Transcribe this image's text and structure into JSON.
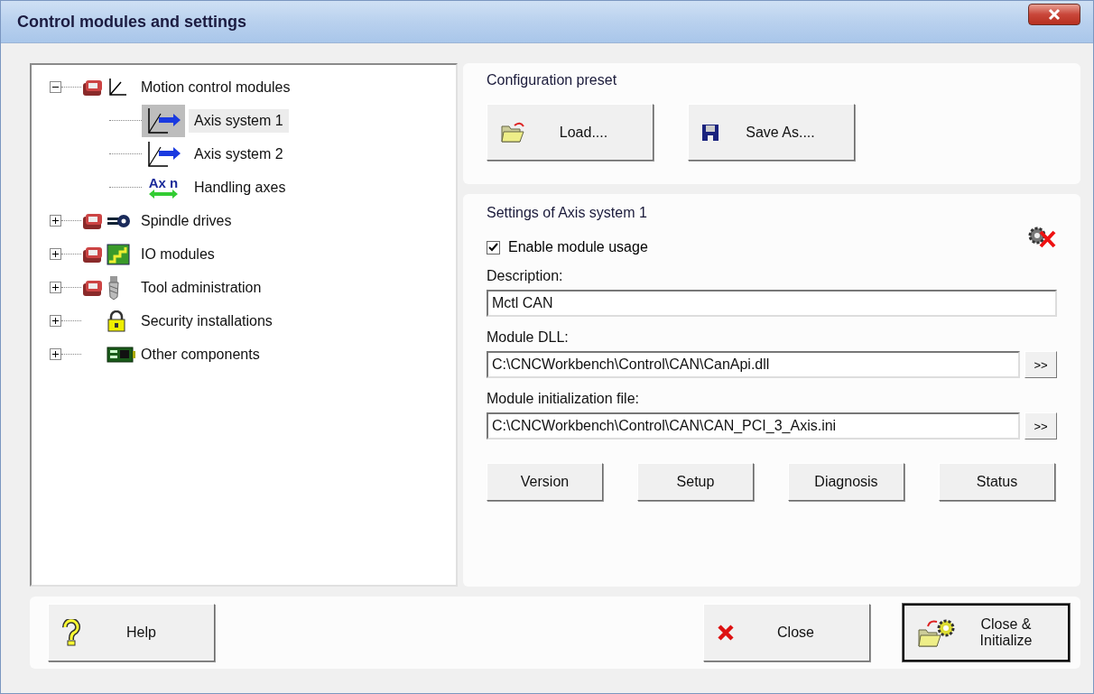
{
  "window": {
    "title": "Control modules and settings"
  },
  "tree": [
    {
      "label": "Motion control modules",
      "expanded": true,
      "selected": false,
      "children": [
        {
          "label": "Axis system 1",
          "selected": true
        },
        {
          "label": "Axis system 2",
          "selected": false
        },
        {
          "label": "Handling axes",
          "selected": false,
          "icon_text": "Ax n"
        }
      ]
    },
    {
      "label": "Spindle drives",
      "expanded": false,
      "selected": false
    },
    {
      "label": "IO modules",
      "expanded": false,
      "selected": false
    },
    {
      "label": "Tool administration",
      "expanded": false,
      "selected": false
    },
    {
      "label": "Security installations",
      "expanded": false,
      "selected": false
    },
    {
      "label": "Other components",
      "expanded": false,
      "selected": false
    }
  ],
  "preset": {
    "heading": "Configuration preset",
    "buttons": [
      "Load....",
      "Save As...."
    ]
  },
  "settings": {
    "heading": "Settings of Axis system 1",
    "enable": {
      "label": "Enable module usage",
      "checked": true
    },
    "fields": [
      {
        "label": "Description:",
        "value": "Mctl CAN"
      },
      {
        "label": "Module DLL:",
        "value": "C:\\CNCWorkbench\\Control\\CAN\\CanApi.dll",
        "browse": ">>"
      },
      {
        "label": "Module initialization file:",
        "value": "C:\\CNCWorkbench\\Control\\CAN\\CAN_PCI_3_Axis.ini",
        "browse": ">>"
      }
    ],
    "buttons": [
      "Version",
      "Setup",
      "Diagnosis",
      "Status"
    ]
  },
  "footer": {
    "help": "Help",
    "close": "Close",
    "close_init": [
      "Close &",
      "Initialize"
    ]
  }
}
